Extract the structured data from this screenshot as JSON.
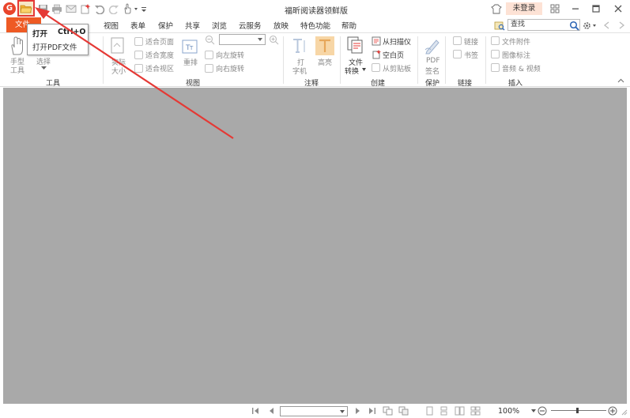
{
  "window": {
    "title": "福昕阅读器领鲜版",
    "login": "未登录",
    "colors": {
      "accent": "#ee5a24",
      "highlight": "#e53935",
      "login_bg": "#fde2d5",
      "doc_bg": "#a9a9a9"
    }
  },
  "quick_access": {
    "icons": [
      "app-logo-icon",
      "open-folder-icon",
      "save-icon",
      "print-icon",
      "email-icon",
      "new-icon",
      "undo-icon",
      "redo-icon",
      "hand-icon",
      "customize-icon"
    ],
    "logo_letter": "G"
  },
  "tabs": {
    "file": "文件",
    "items": [
      "视图",
      "表单",
      "保护",
      "共享",
      "浏览",
      "云服务",
      "放映",
      "特色功能",
      "帮助"
    ]
  },
  "search": {
    "placeholder": "查找"
  },
  "ribbon": {
    "tools": {
      "hand": "手型\n工具",
      "hand_l1": "手型",
      "hand_l2": "工具",
      "select": "选择",
      "label": "工具"
    },
    "view": {
      "actual_size_l1": "实际",
      "actual_size_l2": "大小",
      "fit_page": "适合页面",
      "fit_width": "适合宽度",
      "fit_visible": "适合视区",
      "reflow": "重排",
      "rotate_left": "向左旋转",
      "rotate_right": "向右旋转",
      "label": "视图"
    },
    "annotate": {
      "typewriter_l1": "打",
      "typewriter_l2": "字机",
      "highlight": "高亮",
      "label": "注释"
    },
    "create": {
      "convert_l1": "文件",
      "convert_l2": "转换",
      "from_scanner": "从扫描仪",
      "blank_page": "空白页",
      "from_clipboard": "从剪贴板",
      "label": "创建"
    },
    "protect": {
      "sign_l1": "PDF",
      "sign_l2": "签名",
      "label": "保护"
    },
    "links": {
      "link": "链接",
      "bookmark": "书签",
      "label": "链接"
    },
    "insert": {
      "attachment": "文件附件",
      "image_annot": "图像标注",
      "audio_video": "音频 & 视频",
      "label": "插入"
    }
  },
  "dropdown": {
    "title": "打开",
    "shortcut": "Ctrl+O",
    "item": "打开PDF文件"
  },
  "status": {
    "zoom": "100%"
  }
}
